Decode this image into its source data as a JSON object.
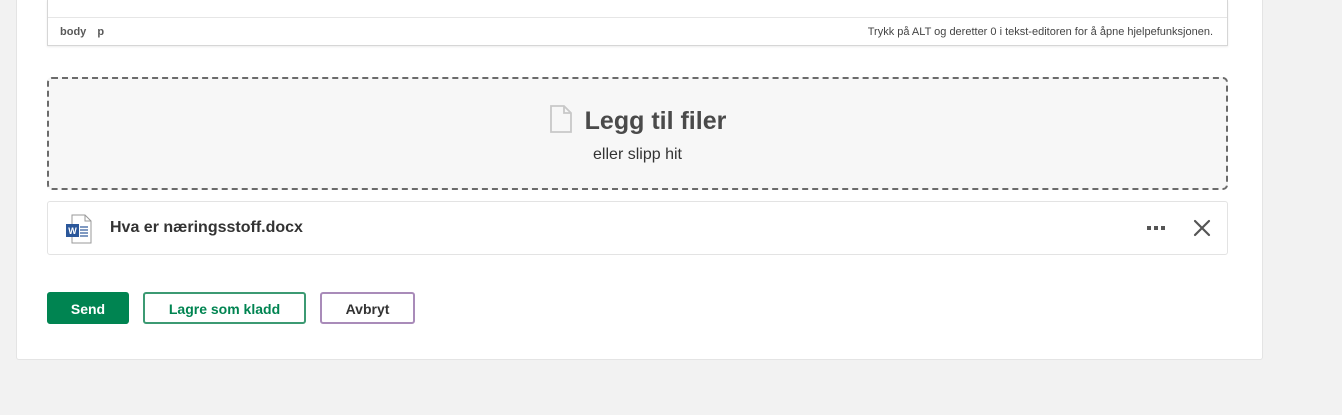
{
  "editor": {
    "path": [
      "body",
      "p"
    ],
    "help_text": "Trykk på ALT og deretter 0 i tekst-editoren for å åpne hjelpefunksjonen."
  },
  "dropzone": {
    "title": "Legg til filer",
    "subtitle": "eller slipp hit",
    "icon": "file-icon"
  },
  "attachments": [
    {
      "name": "Hva er næringsstoff.docx",
      "icon": "word-document-icon"
    }
  ],
  "actions": {
    "send": "Send",
    "save_draft": "Lagre som kladd",
    "cancel": "Avbryt"
  },
  "colors": {
    "primary": "#008451",
    "cancel_border": "#a98bb9",
    "background": "#f2f2f2"
  }
}
